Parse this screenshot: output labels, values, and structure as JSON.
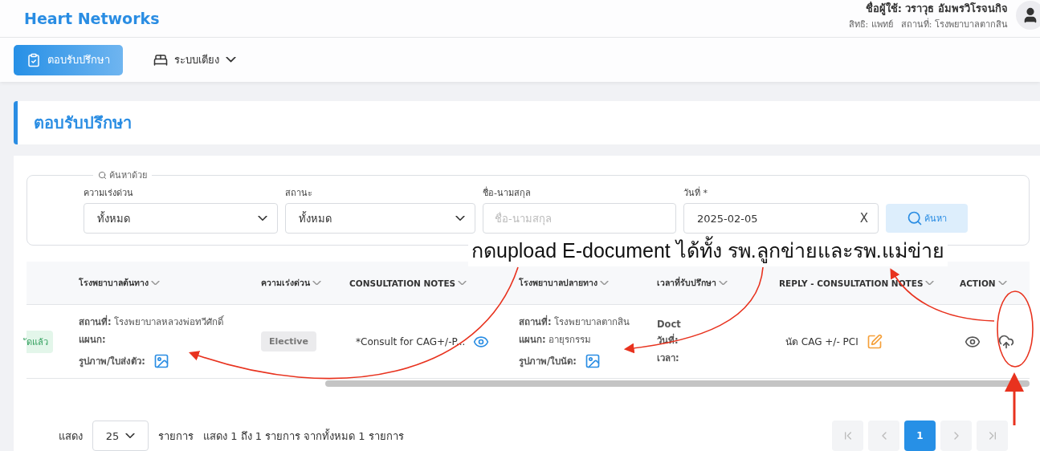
{
  "header": {
    "brand": "Heart Networks",
    "user_name": "ชื่อผู้ใช้: วราวุธ อัมพรวิโรจนกิจ",
    "user_role": "สิทธิ: แพทย์",
    "user_location": "สถานที่: โรงพยาบาลตากสิน"
  },
  "nav": [
    {
      "label": "ตอบรับปรึกษา",
      "kind": "clipboard",
      "selected": true,
      "dropdown": false
    },
    {
      "label": "ระบบเตียง",
      "kind": "bed",
      "selected": false,
      "dropdown": true
    }
  ],
  "page_title": "ตอบรับปรึกษา",
  "search": {
    "legend": "ค้นหาด้วย",
    "fields": [
      {
        "label": "ความเร่งด่วน",
        "kind": "select",
        "value": "ทั้งหมด"
      },
      {
        "label": "สถานะ",
        "kind": "select",
        "value": "ทั้งหมด"
      },
      {
        "label": "ชื่อ-นามสกุล",
        "kind": "text",
        "placeholder": "ชื่อ-นามสกุล"
      },
      {
        "label": "วันที่ *",
        "kind": "date",
        "value": "2025-02-05",
        "clear": "X"
      }
    ],
    "button": "ค้นหา"
  },
  "table": {
    "columns": [
      "โรงพยาบาลต้นทาง",
      "ความเร่งด่วน",
      "CONSULTATION NOTES",
      "โรงพยาบาลปลายทาง",
      "เวลาที่รับปรึกษา",
      "REPLY - CONSULTATION NOTES",
      "ACTION"
    ],
    "rows": [
      {
        "status": "ัดแล้ว",
        "origin": {
          "location_label": "สถานที่:",
          "location": "โรงพยาบาลหลวงพ่อทวีศักดิ์",
          "department_label": "แผนก:",
          "attachment_label": "รูปภาพ/ใบส่งตัว:"
        },
        "urgency": "Elective",
        "note": "*Consult for CAG+/-P...",
        "destination": {
          "location_label": "สถานที่:",
          "location": "โรงพยาบาลตากสิน",
          "department_label": "แผนก:",
          "department": "อายุรกรรม",
          "attachment_label": "รูปภาพ/ใบนัด:"
        },
        "time": {
          "doctor": "Doct",
          "date_label": "วันที่:",
          "time_label": "เวลา:"
        },
        "reply": "นัด CAG +/- PCI"
      }
    ]
  },
  "footer": {
    "show_label": "แสดง",
    "page_size": "25",
    "unit": "รายการ",
    "summary": "แสดง 1 ถึง 1 รายการ จากทั้งหมด 1 รายการ",
    "nav": [
      {
        "kind": "first",
        "disabled": true
      },
      {
        "kind": "prev",
        "disabled": true
      },
      {
        "kind": "page",
        "label": "1",
        "selected": true
      },
      {
        "kind": "next",
        "disabled": true
      },
      {
        "kind": "last",
        "disabled": true
      }
    ]
  },
  "annotation": {
    "text": "กดupload E-document ได้ทั้ง รพ.ลูกข่ายและรพ.แม่ข่าย"
  }
}
